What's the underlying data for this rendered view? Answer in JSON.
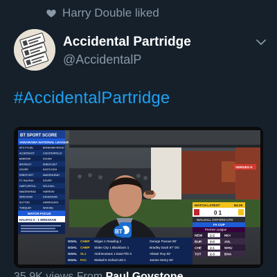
{
  "social_context": {
    "icon": "heart-icon",
    "text": "Harry Double liked"
  },
  "author": {
    "name": "Accidental Partridge",
    "handle": "@AccidentalP",
    "avatar_icon": "avatar-cards-icon"
  },
  "tweet": {
    "hashtag": "#AccidentalPartridge"
  },
  "media": {
    "broadcaster": "BT SPORT SCORE",
    "league_header": "VANARAMA NATIONAL LEAGUE",
    "left_table": [
      [
        "AFC FYLDE",
        "BOREHAM WOOD"
      ],
      [
        "ALDERSHOT",
        "CHESTERFIELD"
      ],
      [
        "BARROW",
        "DOVER"
      ],
      [
        "BROMLEY",
        "EBBSFLEET"
      ],
      [
        "DOVER",
        "EASTLEIGH"
      ],
      [
        "EBBSFLEET",
        "MAIDENHEAD"
      ],
      [
        "FC HALIFAX",
        "DOVER"
      ],
      [
        "HARTLEPOOL",
        "SOLIHULL"
      ],
      [
        "MAIDENHEAD",
        "HARROW"
      ],
      [
        "WREXHAM",
        "DAGENHAM"
      ],
      [
        "SUTTON",
        "HARROGATE"
      ],
      [
        "TORQUAY",
        "WOKING"
      ]
    ],
    "match_focus_label": "MATCH FOCUS",
    "match_focus_score": "HALIFAX 0 - 1 WREXHAM",
    "bt_badge": "BT",
    "ticker": [
      [
        "GOAL",
        "CHMP",
        "Wigan 1 Reading 2"
      ],
      [
        "GOAL",
        "CHMP",
        "Stoke City 1 Blackburn 1"
      ],
      [
        "GOAL",
        "SL1",
        "Airdrieonians 1 East Fife 0"
      ],
      [
        "GOAL",
        "FAC",
        "Walsall 0 Oxford Utd 1"
      ]
    ],
    "scorers": [
      "George Puscas 80'",
      "Bradley Dack 87' OG",
      "Alistair Roy 83'",
      "James Henry 84'"
    ],
    "match_latest_label": "MATCH LATEST",
    "match_latest_clock": "84:26",
    "match_latest_score": "0 1",
    "match_latest_teams": "WALSALL OXFORD UTD",
    "cup_label": "FA CUP",
    "prem_label": "Premier League",
    "side_scores": [
      [
        "NEW",
        "2-2",
        "MCI"
      ],
      [
        "BUR",
        "0-0",
        "AVL"
      ],
      [
        "CHE",
        "2-1",
        "WHU"
      ],
      [
        "TOT",
        "2-3",
        "BHA"
      ]
    ],
    "ground_sign": "VERGES K"
  },
  "footer": {
    "views": "35.9K views",
    "from_label": "From",
    "from_user": "Paul Govstone"
  },
  "colors": {
    "background": "#15202b",
    "primary_text": "#ffffff",
    "secondary_text": "#8899a6",
    "accent": "#1da1f2"
  }
}
